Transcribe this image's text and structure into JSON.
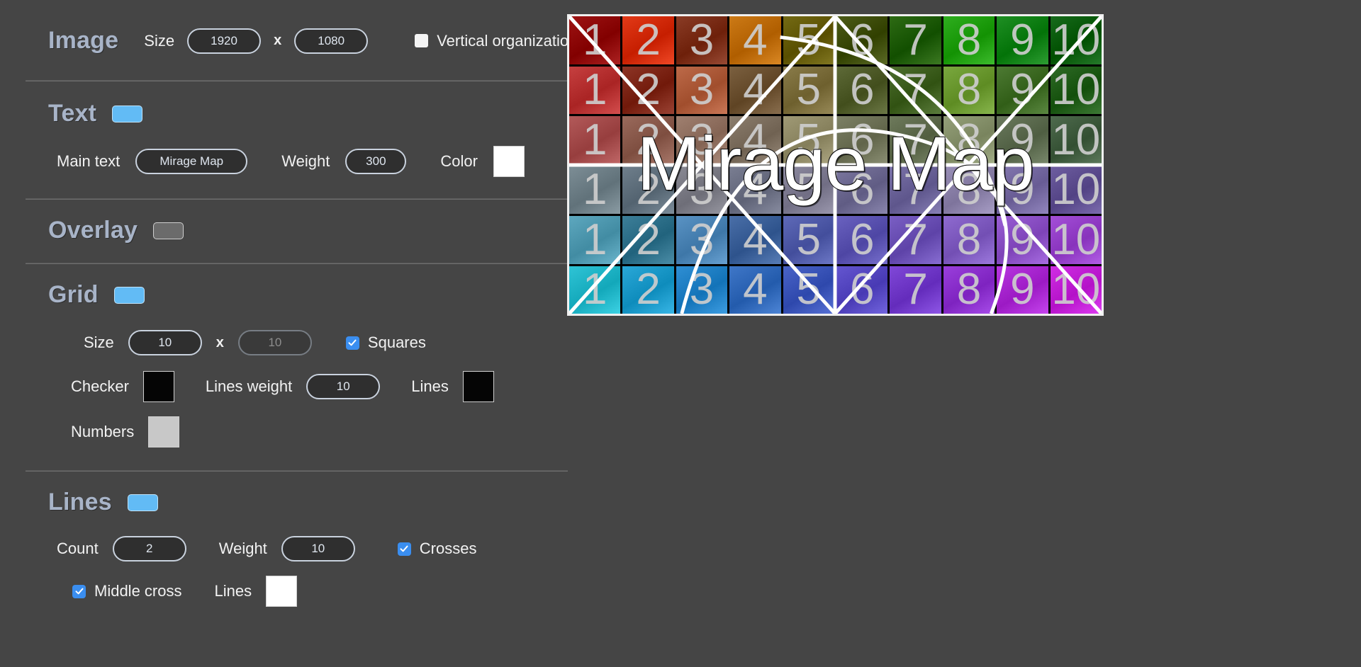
{
  "sections": {
    "image": {
      "title": "Image",
      "size_label": "Size",
      "width": "1920",
      "height": "1080",
      "times": "x",
      "vertical_organization_label": "Vertical organization",
      "vertical_organization_checked": false
    },
    "text": {
      "title": "Text",
      "enabled": true,
      "main_text_label": "Main text",
      "main_text_value": "Mirage Map",
      "weight_label": "Weight",
      "weight_value": "300",
      "color_label": "Color",
      "color_value": "#ffffff"
    },
    "overlay": {
      "title": "Overlay",
      "enabled": false
    },
    "grid": {
      "title": "Grid",
      "enabled": true,
      "size_label": "Size",
      "cols": "10",
      "rows": "10",
      "times": "x",
      "squares_label": "Squares",
      "squares_checked": true,
      "checker_label": "Checker",
      "checker_color": "#050505",
      "lines_weight_label": "Lines weight",
      "lines_weight_value": "10",
      "lines_label": "Lines",
      "lines_color": "#050505",
      "numbers_label": "Numbers",
      "numbers_color": "#c8c8c8"
    },
    "lines": {
      "title": "Lines",
      "enabled": true,
      "count_label": "Count",
      "count_value": "2",
      "weight_label": "Weight",
      "weight_value": "10",
      "crosses_label": "Crosses",
      "crosses_checked": true,
      "middle_cross_label": "Middle cross",
      "middle_cross_checked": true,
      "lines_color_label": "Lines",
      "lines_color_value": "#ffffff"
    }
  },
  "preview": {
    "main_text": "Mirage Map",
    "columns": 10,
    "rows": 6,
    "cell_numbers": [
      "1",
      "2",
      "3",
      "4",
      "5",
      "6",
      "7",
      "8",
      "9",
      "10"
    ],
    "cell_colors": [
      [
        "#9e1414",
        "#e23a18",
        "#8a3c26",
        "#cc7a16",
        "#746a14",
        "#4d5c18",
        "#2e6b14",
        "#2fae1f",
        "#1f8f24",
        "#176b1c"
      ],
      [
        "#c64040",
        "#8d3526",
        "#bd6a49",
        "#7b6040",
        "#8a7c4a",
        "#5e6a38",
        "#4d6e2e",
        "#7aa83f",
        "#4d7a33",
        "#2f6b27"
      ],
      [
        "#b35a5a",
        "#9a6a5c",
        "#a08070",
        "#8c7e6e",
        "#a09a76",
        "#7d8166",
        "#6e7a5c",
        "#95a07a",
        "#6b7a5e",
        "#4f6b4e"
      ],
      [
        "#7d8e96",
        "#6f7f8c",
        "#8a8a94",
        "#7a7e92",
        "#8d8aa0",
        "#7c78a0",
        "#7a72a8",
        "#9a90b8",
        "#8478b0",
        "#6e5ea0"
      ],
      [
        "#5ea8bf",
        "#3d7f99",
        "#5a93c4",
        "#4a6fa8",
        "#5f6ab8",
        "#6a62c0",
        "#7a5fc4",
        "#8f6bd0",
        "#9a5fd4",
        "#a44fd8"
      ],
      [
        "#2fc4d6",
        "#2aa8d8",
        "#2f8fd4",
        "#3f77c8",
        "#4a64c8",
        "#6456d0",
        "#8048d8",
        "#9a3fdc",
        "#b836e0",
        "#d02ee4"
      ]
    ]
  }
}
